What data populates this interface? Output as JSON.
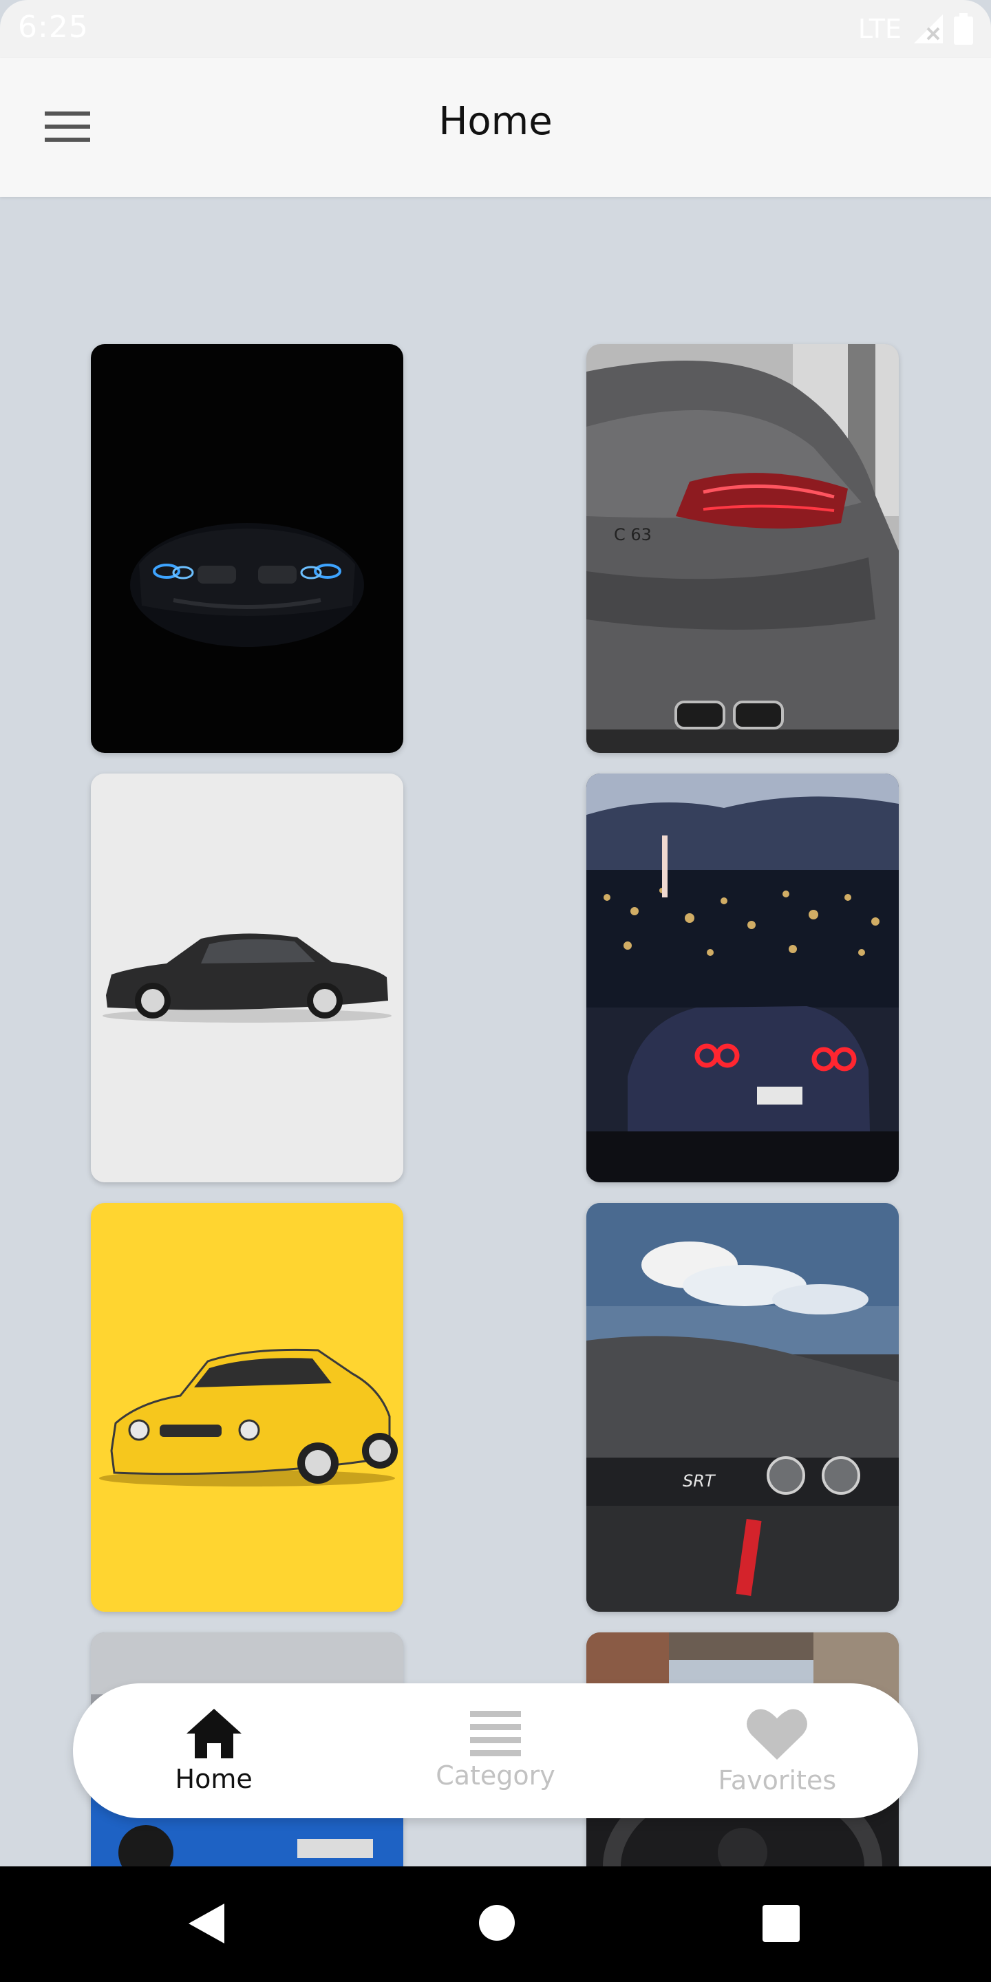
{
  "status_bar": {
    "time": "6:25",
    "network": "LTE"
  },
  "app_bar": {
    "title": "Home"
  },
  "colors": {
    "accent": "#111111",
    "inactive": "#c2c2c2",
    "background": "#d3d9e0"
  },
  "wallpapers": [
    {
      "name": "dark-bmw-headlights"
    },
    {
      "name": "grey-mercedes-c63-rear"
    },
    {
      "name": "black-mercedes-sedan-illustration"
    },
    {
      "name": "nissan-gtr-night-city"
    },
    {
      "name": "yellow-lexus-illustration"
    },
    {
      "name": "dodge-challenger-srt-clouds"
    },
    {
      "name": "blue-porsche-champion"
    },
    {
      "name": "audi-interior-steering"
    }
  ],
  "bottom_nav": {
    "items": [
      {
        "label": "Home",
        "icon": "home-icon",
        "active": true
      },
      {
        "label": "Category",
        "icon": "list-icon",
        "active": false
      },
      {
        "label": "Favorites",
        "icon": "heart-icon",
        "active": false
      }
    ]
  }
}
